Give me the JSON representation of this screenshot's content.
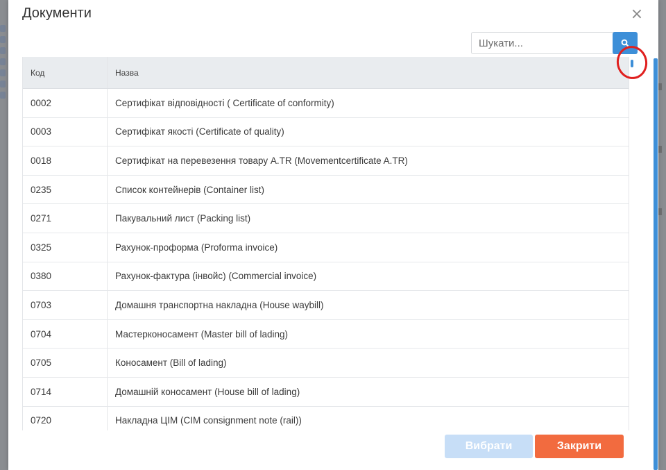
{
  "modal": {
    "title": "Документи",
    "close_icon": "close-icon"
  },
  "search": {
    "placeholder": "Шукати...",
    "value": "",
    "icon": "search-icon"
  },
  "table": {
    "headers": {
      "code": "Код",
      "name": "Назва"
    },
    "rows": [
      {
        "code": "0002",
        "name": "Сертифікат відповідності ( Certificate of conformity)"
      },
      {
        "code": "0003",
        "name": "Сертифікат якості (Certificate of quality)"
      },
      {
        "code": "0018",
        "name": "Сертифікат на перевезення товару A.TR (Movementcertificate A.TR)"
      },
      {
        "code": "0235",
        "name": "Список контейнерів (Container list)"
      },
      {
        "code": "0271",
        "name": "Пакувальний лист (Packing list)"
      },
      {
        "code": "0325",
        "name": "Рахунок-проформа (Proforma invoice)"
      },
      {
        "code": "0380",
        "name": "Рахунок-фактура (інвойс) (Commercial invoice)"
      },
      {
        "code": "0703",
        "name": "Домашня транспортна накладна (House waybill)"
      },
      {
        "code": "0704",
        "name": "Мастерконосамент (Master bill of lading)"
      },
      {
        "code": "0705",
        "name": "Коносамент (Bill of lading)"
      },
      {
        "code": "0714",
        "name": "Домашній коносамент (House bill of lading)"
      },
      {
        "code": "0720",
        "name": "Накладна ЦІМ (CIM consignment note (rail))"
      }
    ]
  },
  "footer": {
    "select_label": "Вибрати",
    "close_label": "Закрити"
  },
  "colors": {
    "accent": "#3d8fd8",
    "select_disabled": "#c7def7",
    "close": "#f26b3f",
    "annotation": "#e0201f"
  }
}
